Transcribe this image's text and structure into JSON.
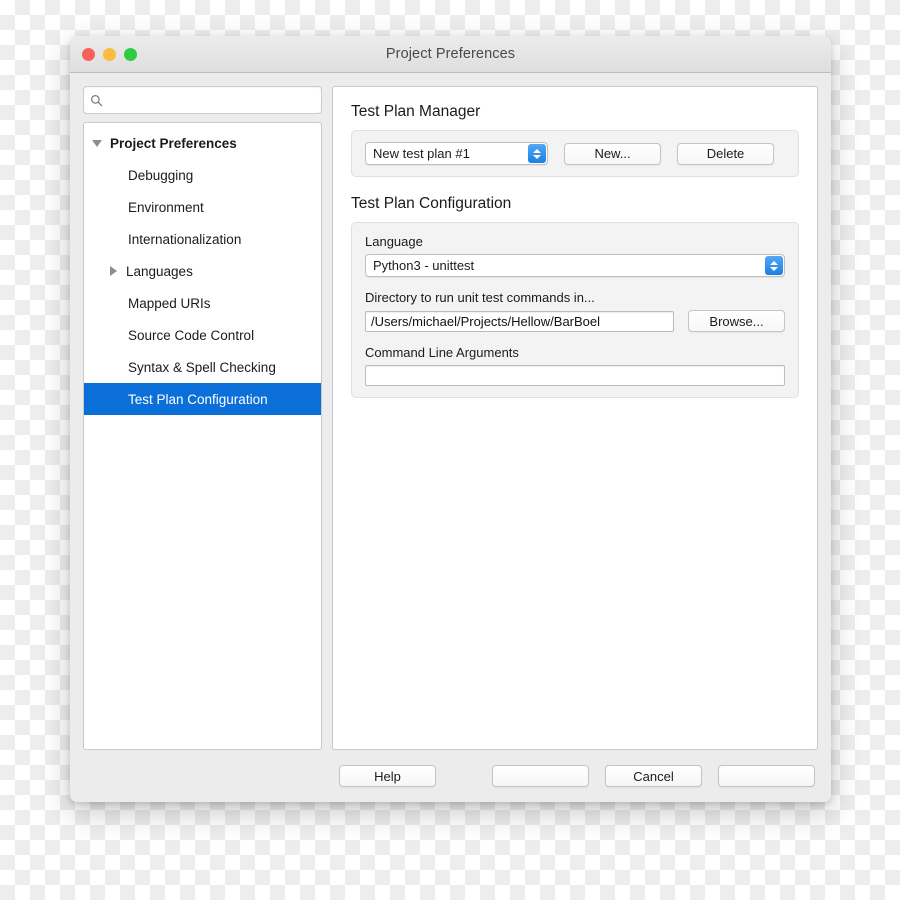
{
  "window": {
    "title": "Project Preferences",
    "traffic_lights": [
      {
        "name": "close",
        "color": "#f9625a"
      },
      {
        "name": "minimize",
        "color": "#fbbd3f"
      },
      {
        "name": "zoom",
        "color": "#2ecc40"
      }
    ]
  },
  "sidebar": {
    "search": {
      "value": "",
      "placeholder": "",
      "icon": "search-icon"
    },
    "tree": [
      {
        "label": "Project Preferences",
        "level": 0,
        "disclosure": "down",
        "selected": false
      },
      {
        "label": "Debugging",
        "level": 1,
        "disclosure": "none",
        "selected": false
      },
      {
        "label": "Environment",
        "level": 1,
        "disclosure": "none",
        "selected": false
      },
      {
        "label": "Internationalization",
        "level": 1,
        "disclosure": "none",
        "selected": false
      },
      {
        "label": "Languages",
        "level": 1,
        "disclosure": "right",
        "selected": false
      },
      {
        "label": "Mapped URIs",
        "level": 1,
        "disclosure": "none",
        "selected": false
      },
      {
        "label": "Source Code Control",
        "level": 1,
        "disclosure": "none",
        "selected": false
      },
      {
        "label": "Syntax & Spell Checking",
        "level": 1,
        "disclosure": "none",
        "selected": false
      },
      {
        "label": "Test Plan Configuration",
        "level": 1,
        "disclosure": "none",
        "selected": true
      }
    ],
    "selection_color": "#0a6fd8"
  },
  "manager": {
    "title": "Test Plan Manager",
    "plan_select": {
      "value": "New test plan #1"
    },
    "new_button": "New...",
    "delete_button": "Delete"
  },
  "configuration": {
    "title": "Test Plan Configuration",
    "language_label": "Language",
    "language_select": {
      "value": "Python3 - unittest"
    },
    "directory_label": "Directory to run unit test commands in...",
    "directory_field": {
      "value": "/Users/michael/Projects/Hellow/BarBoel",
      "placeholder": ""
    },
    "browse_button": "Browse...",
    "args_label": "Command Line Arguments",
    "args_field": {
      "value": "",
      "placeholder": ""
    }
  },
  "footer": {
    "help_button": "Help",
    "blank_button_1": "",
    "cancel_button": "Cancel",
    "blank_button_2": ""
  }
}
